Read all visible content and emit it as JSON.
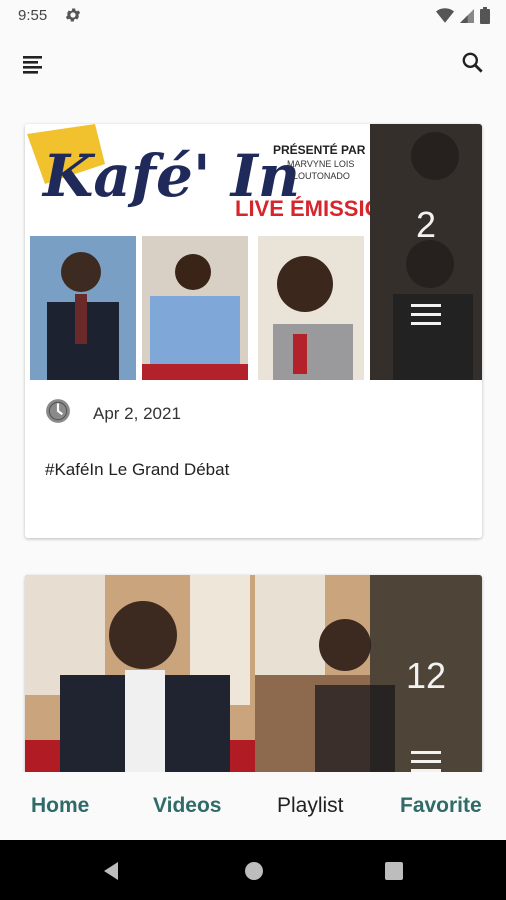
{
  "status": {
    "time": "9:55"
  },
  "cards": [
    {
      "count": "2",
      "date": "Apr 2, 2021",
      "title": "#KaféIn Le Grand Débat",
      "thumb_text": {
        "logo": "Kafé' In",
        "presented": "PRÉSENTÉ PAR",
        "presenter_line1": "MARVYNE LOIS",
        "presenter_line2": "LOUTONADO",
        "banner": "LIVE ÉMISSION SPÉCIALE"
      }
    },
    {
      "count": "12"
    }
  ],
  "nav": {
    "home": "Home",
    "videos": "Videos",
    "playlist": "Playlist",
    "favorite": "Favorite"
  },
  "colors": {
    "accent": "#2f6b68",
    "overlay": "#1e1e1e",
    "banner_red": "#d6262b",
    "logo_navy": "#1f2a5a",
    "logo_yellow": "#f2c12e"
  }
}
